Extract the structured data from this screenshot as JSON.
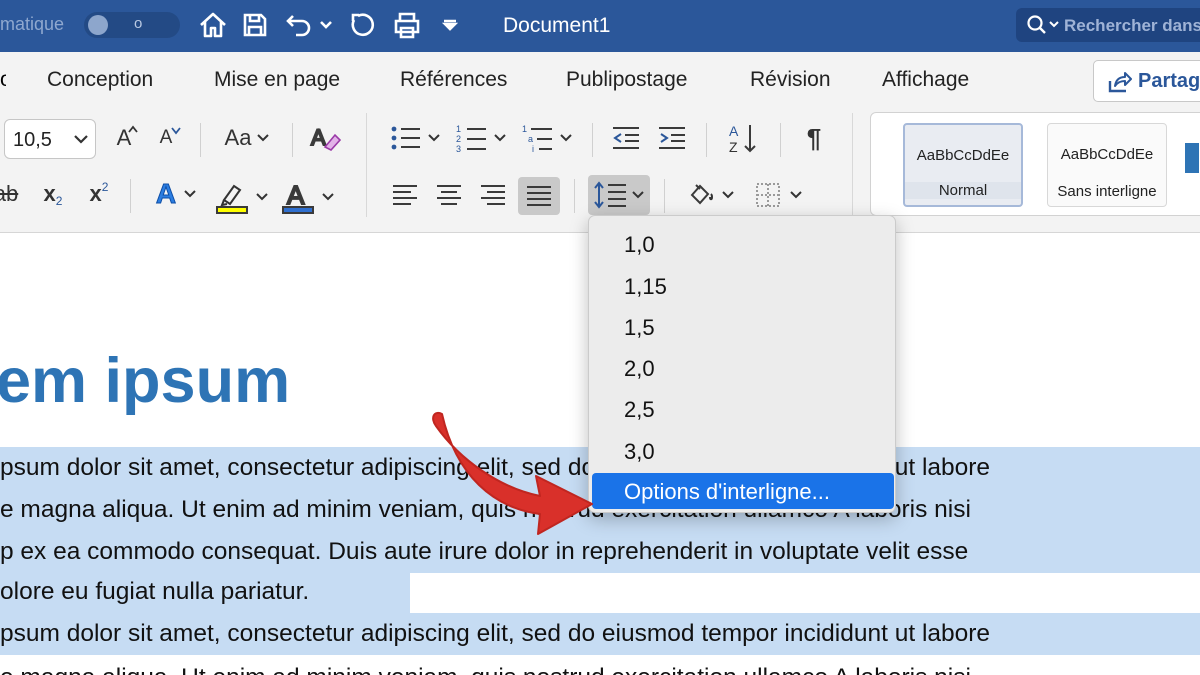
{
  "titlebar": {
    "autosave_fragment": "matique",
    "toggle_state": "o",
    "document_title": "Document1",
    "search_placeholder": "Rechercher dans"
  },
  "tabs": [
    {
      "label": "Conception"
    },
    {
      "label": "Mise en page"
    },
    {
      "label": "Références"
    },
    {
      "label": "Publipostage"
    },
    {
      "label": "Révision"
    },
    {
      "label": "Affichage"
    }
  ],
  "share": {
    "label": "Partag"
  },
  "ribbon": {
    "font_size": "10,5",
    "grow_font": "A",
    "shrink_font": "A",
    "change_case": "Aa",
    "subscript": "x",
    "superscript": "x",
    "styles": [
      {
        "preview": "AaBbCcDdEe",
        "name": "Normal",
        "selected": true
      },
      {
        "preview": "AaBbCcDdEe",
        "name": "Sans interligne",
        "selected": false
      }
    ]
  },
  "document": {
    "heading": "em ipsum",
    "lines": [
      {
        "text": "psum dolor sit amet, consectetur adipiscing elit, sed do eiusmod tempor incididunt ut labore",
        "highlighted": true
      },
      {
        "text": "e magna aliqua. Ut enim ad minim veniam, quis nostrud exercitation ullamco A laboris nisi",
        "highlighted": true
      },
      {
        "text": "p ex ea commodo consequat. Duis aute irure dolor in reprehenderit in voluptate velit esse",
        "highlighted": true
      },
      {
        "text": "olore eu fugiat nulla pariatur.",
        "highlighted": true
      },
      {
        "text": "psum dolor sit amet, consectetur adipiscing elit, sed do eiusmod tempor incididunt ut labore",
        "highlighted": true
      },
      {
        "text": "e magna aliqua. Ut enim ad minim veniam, quis nostrud exercitation ullamco A laboris nisi",
        "highlighted": false
      }
    ]
  },
  "line_spacing_menu": {
    "options": [
      "1,0",
      "1,15",
      "1,5",
      "2,0",
      "2,5",
      "3,0"
    ],
    "more_options_label": "Options d'interligne..."
  },
  "colors": {
    "title_bar": "#2b579a",
    "ribbon_bg": "#f3f3f3",
    "heading": "#2e74b5",
    "selection": "#c6dcf3",
    "menu_highlight": "#1a73e8",
    "arrow": "#d9302a",
    "text_effect": "#2b7de1",
    "highlight_yellow": "#ffff00",
    "font_color_blue": "#2f6fcf"
  }
}
